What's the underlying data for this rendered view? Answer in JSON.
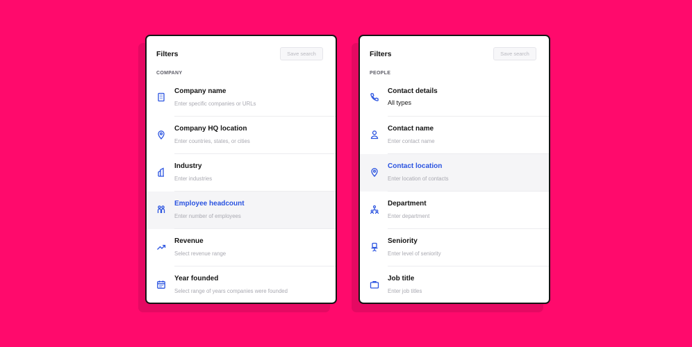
{
  "colors": {
    "background": "#ff0a6c",
    "accent": "#2a53e0",
    "text": "#141414",
    "muted": "#a9a9b1"
  },
  "company_panel": {
    "title": "Filters",
    "save_label": "Save search",
    "section": "COMPANY",
    "items": [
      {
        "icon": "building-icon",
        "label": "Company name",
        "sub": "Enter specific companies or URLs",
        "active": false
      },
      {
        "icon": "location-pin-icon",
        "label": "Company HQ location",
        "sub": "Enter countries, states, or cities",
        "active": false
      },
      {
        "icon": "industry-icon",
        "label": "Industry",
        "sub": "Enter industries",
        "active": false
      },
      {
        "icon": "people-group-icon",
        "label": "Employee headcount",
        "sub": "Enter number of employees",
        "active": true
      },
      {
        "icon": "trending-up-icon",
        "label": "Revenue",
        "sub": "Select revenue range",
        "active": false
      },
      {
        "icon": "calendar-icon",
        "label": "Year founded",
        "sub": "Select range of years companies were founded",
        "active": false
      }
    ]
  },
  "people_panel": {
    "title": "Filters",
    "save_label": "Save search",
    "section": "PEOPLE",
    "items": [
      {
        "icon": "phone-icon",
        "label": "Contact details",
        "sub": "All types",
        "active": false
      },
      {
        "icon": "person-icon",
        "label": "Contact name",
        "sub": "Enter contact name",
        "active": false
      },
      {
        "icon": "location-pin-icon",
        "label": "Contact location",
        "sub": "Enter location of contacts",
        "active": true
      },
      {
        "icon": "org-chart-icon",
        "label": "Department",
        "sub": "Enter department",
        "active": false
      },
      {
        "icon": "chair-icon",
        "label": "Seniority",
        "sub": "Enter level of seniority",
        "active": false
      },
      {
        "icon": "briefcase-icon",
        "label": "Job title",
        "sub": "Enter job titles",
        "active": false
      }
    ]
  }
}
